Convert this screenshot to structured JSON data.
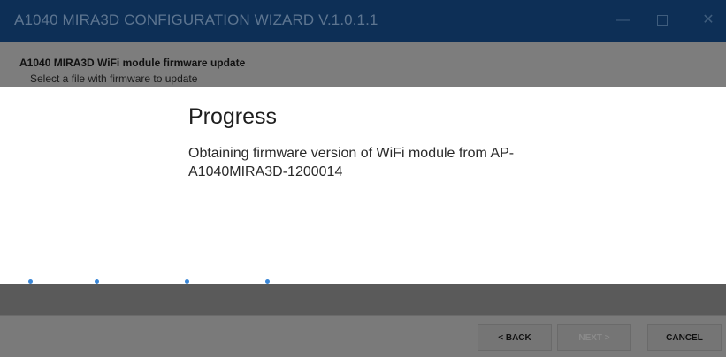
{
  "window": {
    "title": "A1040 MIRA3D CONFIGURATION WIZARD V.1.0.1.1",
    "controls": [
      "minimize-icon",
      "maximize-icon",
      "close-icon"
    ]
  },
  "header": {
    "title": "A1040 MIRA3D WiFi module firmware update",
    "subtitle": "Select a file with firmware to update"
  },
  "progress": {
    "title": "Progress",
    "message": "Obtaining firmware version of WiFi module from AP-A1040MIRA3D-1200014",
    "indicator_color": "#3a86d6"
  },
  "footer": {
    "back_label": "< BACK",
    "next_label": "NEXT >",
    "cancel_label": "CANCEL"
  }
}
